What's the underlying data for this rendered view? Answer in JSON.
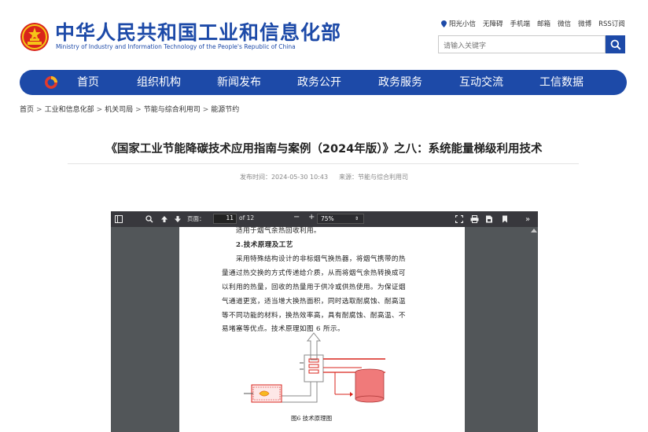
{
  "header": {
    "title": "中华人民共和国工业和信息化部",
    "subtitle": "Ministry of Industry and Information Technology of the People's Republic of China",
    "links": [
      "阳光小信",
      "无障碍",
      "手机端",
      "邮箱",
      "微信",
      "微博",
      "RSS订阅"
    ],
    "search_placeholder": "请输入关键字",
    "brand_color": "#1d4aa8"
  },
  "nav": {
    "items": [
      "首页",
      "组织机构",
      "新闻发布",
      "政务公开",
      "政务服务",
      "互动交流",
      "工信数据"
    ]
  },
  "breadcrumb": [
    "首页",
    "工业和信息化部",
    "机关司局",
    "节能与综合利用司",
    "能源节约"
  ],
  "article": {
    "title": "《国家工业节能降碳技术应用指南与案例（2024年版）》之八：系统能量梯级利用技术",
    "publish_time": "发布时间：2024-05-30 10:43",
    "source": "来源：节能与综合利用司"
  },
  "pdf_viewer": {
    "page_label": "页面：",
    "current_page": "11",
    "total_pages": "of 12",
    "zoom": "75%",
    "minus": "−",
    "plus": "+",
    "lines": [
      "适用于烟气余热回收利用。",
      "2.技术原理及工艺",
      "采用特殊结构设计的非标烟气换热器，将烟气携带的热",
      "量通过热交换的方式传递给介质，从而将烟气余热转换成可",
      "以利用的热量，回收的热量用于供冷或供热使用。为保证烟",
      "气通道更宽，适当增大换热面积，同时选取耐腐蚀、耐高温",
      "等不同功能的材料，换热效率高，具有耐腐蚀、耐高温、不",
      "易堵塞等优点。技术原理如图 6 所示。"
    ],
    "figure_caption": "图6 技术原理图"
  }
}
